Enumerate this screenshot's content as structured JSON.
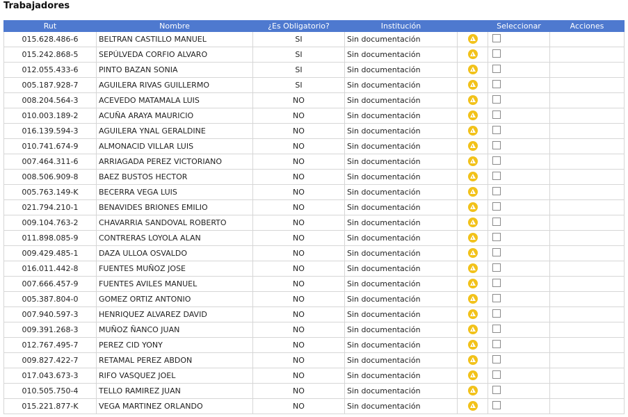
{
  "page_title": "Trabajadores",
  "columns": {
    "rut": "Rut",
    "nombre": "Nombre",
    "obligatorio": "¿Es Obligatorio?",
    "institucion": "Institución",
    "seleccionar": "Seleccionar",
    "acciones": "Acciones"
  },
  "status_icon": "warning-icon",
  "colors": {
    "header_bg": "#4e79cf",
    "warning": "#f2c21a"
  },
  "rows": [
    {
      "rut": "015.628.486-6",
      "nombre": "BELTRAN CASTILLO MANUEL",
      "obligatorio": "SI",
      "institucion": "Sin documentación",
      "selected": false
    },
    {
      "rut": "015.242.868-5",
      "nombre": "SEPÚLVEDA CORFIO ALVARO",
      "obligatorio": "SI",
      "institucion": "Sin documentación",
      "selected": false
    },
    {
      "rut": "012.055.433-6",
      "nombre": "PINTO BAZAN SONIA",
      "obligatorio": "SI",
      "institucion": "Sin documentación",
      "selected": false
    },
    {
      "rut": "005.187.928-7",
      "nombre": "AGUILERA RIVAS GUILLERMO",
      "obligatorio": "SI",
      "institucion": "Sin documentación",
      "selected": false
    },
    {
      "rut": "008.204.564-3",
      "nombre": "ACEVEDO MATAMALA LUIS",
      "obligatorio": "NO",
      "institucion": "Sin documentación",
      "selected": false
    },
    {
      "rut": "010.003.189-2",
      "nombre": "ACUÑA ARAYA MAURICIO",
      "obligatorio": "NO",
      "institucion": "Sin documentación",
      "selected": false
    },
    {
      "rut": "016.139.594-3",
      "nombre": "AGUILERA YNAL GERALDINE",
      "obligatorio": "NO",
      "institucion": "Sin documentación",
      "selected": false
    },
    {
      "rut": "010.741.674-9",
      "nombre": "ALMONACID VILLAR LUIS",
      "obligatorio": "NO",
      "institucion": "Sin documentación",
      "selected": false
    },
    {
      "rut": "007.464.311-6",
      "nombre": "ARRIAGADA PEREZ VICTORIANO",
      "obligatorio": "NO",
      "institucion": "Sin documentación",
      "selected": false
    },
    {
      "rut": "008.506.909-8",
      "nombre": "BAEZ BUSTOS HECTOR",
      "obligatorio": "NO",
      "institucion": "Sin documentación",
      "selected": false
    },
    {
      "rut": "005.763.149-K",
      "nombre": "BECERRA VEGA LUIS",
      "obligatorio": "NO",
      "institucion": "Sin documentación",
      "selected": false
    },
    {
      "rut": "021.794.210-1",
      "nombre": "BENAVIDES BRIONES EMILIO",
      "obligatorio": "NO",
      "institucion": "Sin documentación",
      "selected": false
    },
    {
      "rut": "009.104.763-2",
      "nombre": "CHAVARRIA SANDOVAL ROBERTO",
      "obligatorio": "NO",
      "institucion": "Sin documentación",
      "selected": false
    },
    {
      "rut": "011.898.085-9",
      "nombre": "CONTRERAS LOYOLA ALAN",
      "obligatorio": "NO",
      "institucion": "Sin documentación",
      "selected": false
    },
    {
      "rut": "009.429.485-1",
      "nombre": "DAZA ULLOA OSVALDO",
      "obligatorio": "NO",
      "institucion": "Sin documentación",
      "selected": false
    },
    {
      "rut": "016.011.442-8",
      "nombre": "FUENTES MUÑOZ JOSE",
      "obligatorio": "NO",
      "institucion": "Sin documentación",
      "selected": false
    },
    {
      "rut": "007.666.457-9",
      "nombre": "FUENTES AVILES MANUEL",
      "obligatorio": "NO",
      "institucion": "Sin documentación",
      "selected": false
    },
    {
      "rut": "005.387.804-0",
      "nombre": "GOMEZ ORTIZ ANTONIO",
      "obligatorio": "NO",
      "institucion": "Sin documentación",
      "selected": false
    },
    {
      "rut": "007.940.597-3",
      "nombre": "HENRIQUEZ ALVAREZ DAVID",
      "obligatorio": "NO",
      "institucion": "Sin documentación",
      "selected": false
    },
    {
      "rut": "009.391.268-3",
      "nombre": "MUÑOZ ÑANCO JUAN",
      "obligatorio": "NO",
      "institucion": "Sin documentación",
      "selected": false
    },
    {
      "rut": "012.767.495-7",
      "nombre": "PEREZ CID YONY",
      "obligatorio": "NO",
      "institucion": "Sin documentación",
      "selected": false
    },
    {
      "rut": "009.827.422-7",
      "nombre": "RETAMAL PEREZ ABDON",
      "obligatorio": "NO",
      "institucion": "Sin documentación",
      "selected": false
    },
    {
      "rut": "017.043.673-3",
      "nombre": "RIFO VASQUEZ JOEL",
      "obligatorio": "NO",
      "institucion": "Sin documentación",
      "selected": false
    },
    {
      "rut": "010.505.750-4",
      "nombre": "TELLO RAMIREZ JUAN",
      "obligatorio": "NO",
      "institucion": "Sin documentación",
      "selected": false
    },
    {
      "rut": "015.221.877-K",
      "nombre": "VEGA MARTINEZ ORLANDO",
      "obligatorio": "NO",
      "institucion": "Sin documentación",
      "selected": false
    }
  ]
}
